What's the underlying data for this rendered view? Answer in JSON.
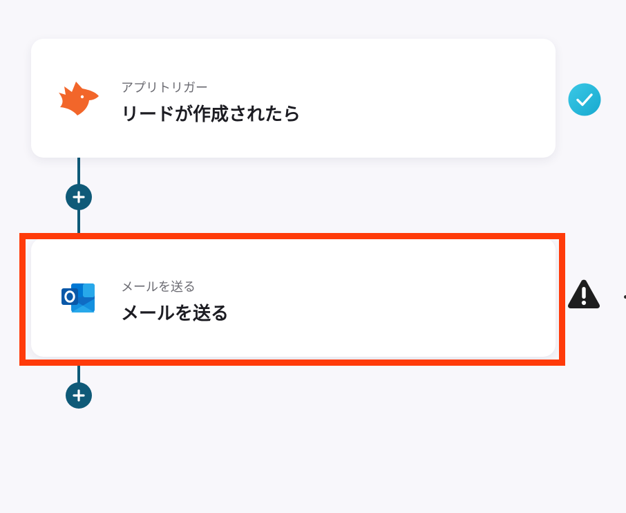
{
  "steps": [
    {
      "subtitle": "アプリトリガー",
      "title": "リードが作成されたら",
      "icon": "fox-app-icon",
      "status": "check-icon",
      "status_color": "#1ab5d6"
    },
    {
      "subtitle": "メールを送る",
      "title": "メールを送る",
      "icon": "outlook-icon",
      "status": "warning-icon",
      "status_color": "#1e1e1e"
    }
  ],
  "colors": {
    "background": "#f8f7fb",
    "connector": "#0f5a78",
    "highlight": "#ff3b0a",
    "fox": "#f2662a",
    "outlook": "#0f6cc4"
  }
}
